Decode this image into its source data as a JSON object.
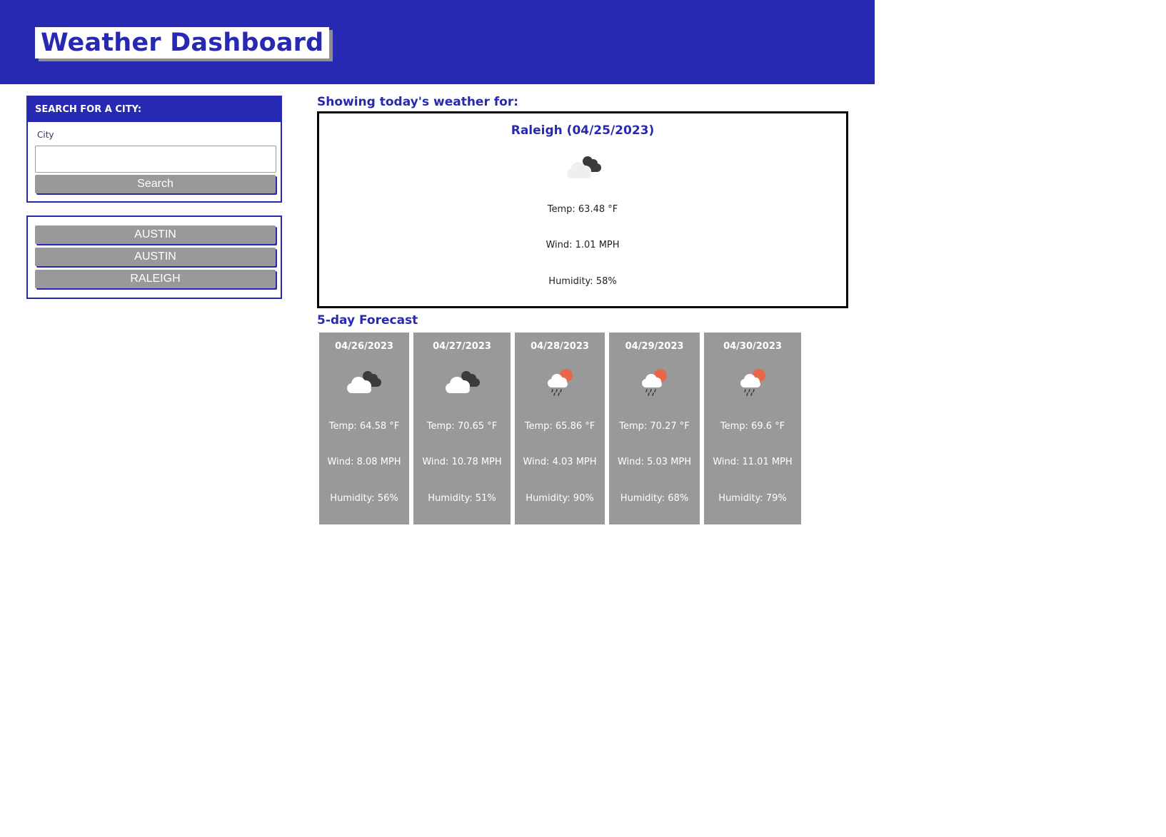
{
  "header": {
    "title": "Weather Dashboard"
  },
  "search": {
    "heading": "SEARCH FOR A CITY:",
    "city_label": "City",
    "input_value": "",
    "button_label": "Search"
  },
  "history": [
    "AUSTIN",
    "AUSTIN",
    "RALEIGH"
  ],
  "today": {
    "heading": "Showing today's weather for:",
    "city_date": "Raleigh (04/25/2023)",
    "icon": "cloudy-icon",
    "temp": "Temp: 63.48 °F",
    "wind": "Wind: 1.01 MPH",
    "humidity": "Humidity: 58%"
  },
  "forecast": {
    "heading": "5-day Forecast",
    "days": [
      {
        "date": "04/26/2023",
        "icon": "cloudy-icon",
        "temp": "Temp: 64.58 °F",
        "wind": "Wind: 8.08 MPH",
        "humidity": "Humidity: 56%"
      },
      {
        "date": "04/27/2023",
        "icon": "cloudy-icon",
        "temp": "Temp: 70.65 °F",
        "wind": "Wind: 10.78 MPH",
        "humidity": "Humidity: 51%"
      },
      {
        "date": "04/28/2023",
        "icon": "rain-sun-icon",
        "temp": "Temp: 65.86 °F",
        "wind": "Wind: 4.03 MPH",
        "humidity": "Humidity: 90%"
      },
      {
        "date": "04/29/2023",
        "icon": "rain-sun-icon",
        "temp": "Temp: 70.27 °F",
        "wind": "Wind: 5.03 MPH",
        "humidity": "Humidity: 68%"
      },
      {
        "date": "04/30/2023",
        "icon": "rain-sun-icon",
        "temp": "Temp: 69.6 °F",
        "wind": "Wind: 11.01 MPH",
        "humidity": "Humidity: 79%"
      }
    ]
  },
  "colors": {
    "primary": "#2829b2",
    "card_bg": "#999999",
    "sun": "#e8664a"
  }
}
